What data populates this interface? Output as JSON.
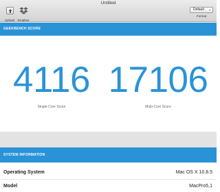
{
  "window": {
    "title": "Untitled"
  },
  "toolbar": {
    "upload_label": "Upload",
    "dropbox_label": "Dropbox",
    "format_value": "Default",
    "format_label": "Format"
  },
  "geekbench": {
    "header": "GEEKBENCH SCORE",
    "single_core": {
      "value": "4116",
      "label": "Single-Core Score"
    },
    "multi_core": {
      "value": "17106",
      "label": "Multi-Core Score"
    }
  },
  "system_info": {
    "header": "SYSTEM INFORMATION",
    "rows": [
      {
        "key": "Operating System",
        "value": "Mac OS X 10.8.5"
      },
      {
        "key": "Model",
        "value": "MacPro5,1"
      }
    ]
  },
  "colors": {
    "accent": "#2a93d8",
    "band": "#e3e3e3"
  }
}
